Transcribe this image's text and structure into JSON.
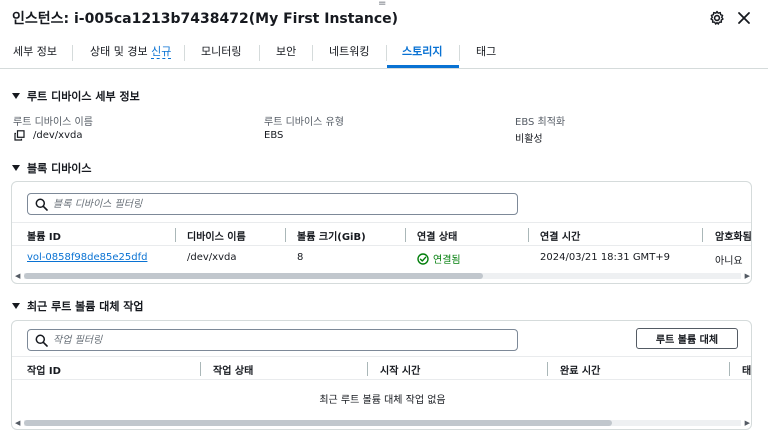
{
  "header": {
    "title": "인스턴스: i-005ca1213b7438472(My First Instance)",
    "drag_glyph": "="
  },
  "tabs": [
    {
      "label": "세부 정보"
    },
    {
      "label": "상태 및 경보",
      "badge": "신규"
    },
    {
      "label": "모니터링"
    },
    {
      "label": "보안"
    },
    {
      "label": "네트워킹"
    },
    {
      "label": "스토리지",
      "active": true
    },
    {
      "label": "태그"
    }
  ],
  "root_device": {
    "heading": "루트 디바이스 세부 정보",
    "fields": [
      {
        "label": "루트 디바이스 이름",
        "value": "/dev/xvda"
      },
      {
        "label": "루트 디바이스 유형",
        "value": "EBS"
      },
      {
        "label": "EBS 최적화",
        "value": "비활성"
      }
    ]
  },
  "block_devices": {
    "heading": "블록 디바이스",
    "search_placeholder": "블록 디바이스 필터링",
    "columns": [
      "볼륨 ID",
      "디바이스 이름",
      "볼륨 크기(GiB)",
      "연결 상태",
      "연결 시간",
      "암호화됨"
    ],
    "rows": [
      {
        "volume_id": "vol-0858f98de85e25dfd",
        "device_name": "/dev/xvda",
        "size": "8",
        "status": "연결됨",
        "attach_time": "2024/03/21 18:31 GMT+9",
        "encrypted": "아니요"
      }
    ],
    "scroll_position": 0.64
  },
  "root_replace": {
    "heading": "최근 루트 볼륨 대체 작업",
    "search_placeholder": "작업 필터링",
    "button_label": "루트 볼륨 대체",
    "columns": [
      "작업 ID",
      "작업 상태",
      "시작 시간",
      "완료 시간",
      "태"
    ],
    "empty_text": "최근 루트 볼륨 대체 작업 없음",
    "scroll_position": 0.82
  },
  "colors": {
    "accent": "#0972d3",
    "success": "#037f0c",
    "text": "#16191f"
  },
  "icons": [
    "settings-gear-icon",
    "close-icon",
    "caret-down-icon",
    "copy-icon",
    "search-icon",
    "status-success-icon"
  ]
}
